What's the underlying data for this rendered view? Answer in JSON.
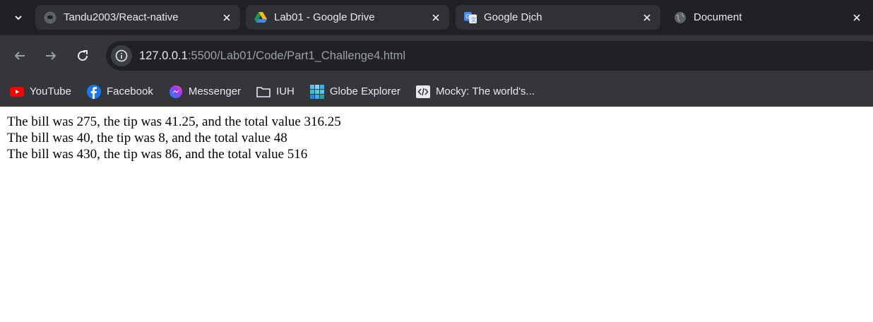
{
  "tabs": [
    {
      "title": "Tandu2003/React-native",
      "icon": "github-icon",
      "active": false
    },
    {
      "title": "Lab01 - Google Drive",
      "icon": "google-drive-icon",
      "active": false
    },
    {
      "title": "Google Dịch",
      "icon": "google-translate-icon",
      "active": false
    },
    {
      "title": "Document",
      "icon": "globe-icon",
      "active": true
    }
  ],
  "address_bar": {
    "host": "127.0.0.1",
    "rest": ":5500/Lab01/Code/Part1_Challenge4.html"
  },
  "bookmarks": [
    {
      "label": "YouTube",
      "icon": "youtube-icon"
    },
    {
      "label": "Facebook",
      "icon": "facebook-icon"
    },
    {
      "label": "Messenger",
      "icon": "messenger-icon"
    },
    {
      "label": "IUH",
      "icon": "folder-icon"
    },
    {
      "label": "Globe Explorer",
      "icon": "globe-explorer-icon"
    },
    {
      "label": "Mocky: The world's...",
      "icon": "mocky-icon"
    }
  ],
  "content": {
    "lines": [
      "The bill was 275, the tip was 41.25, and the total value 316.25",
      "The bill was 40, the tip was 8, and the total value 48",
      "The bill was 430, the tip was 86, and the total value 516"
    ]
  },
  "colors": {
    "tabstrip_bg": "#202124",
    "toolbar_bg": "#35363a",
    "youtube_red": "#ff0000",
    "facebook_blue": "#1877f2"
  }
}
